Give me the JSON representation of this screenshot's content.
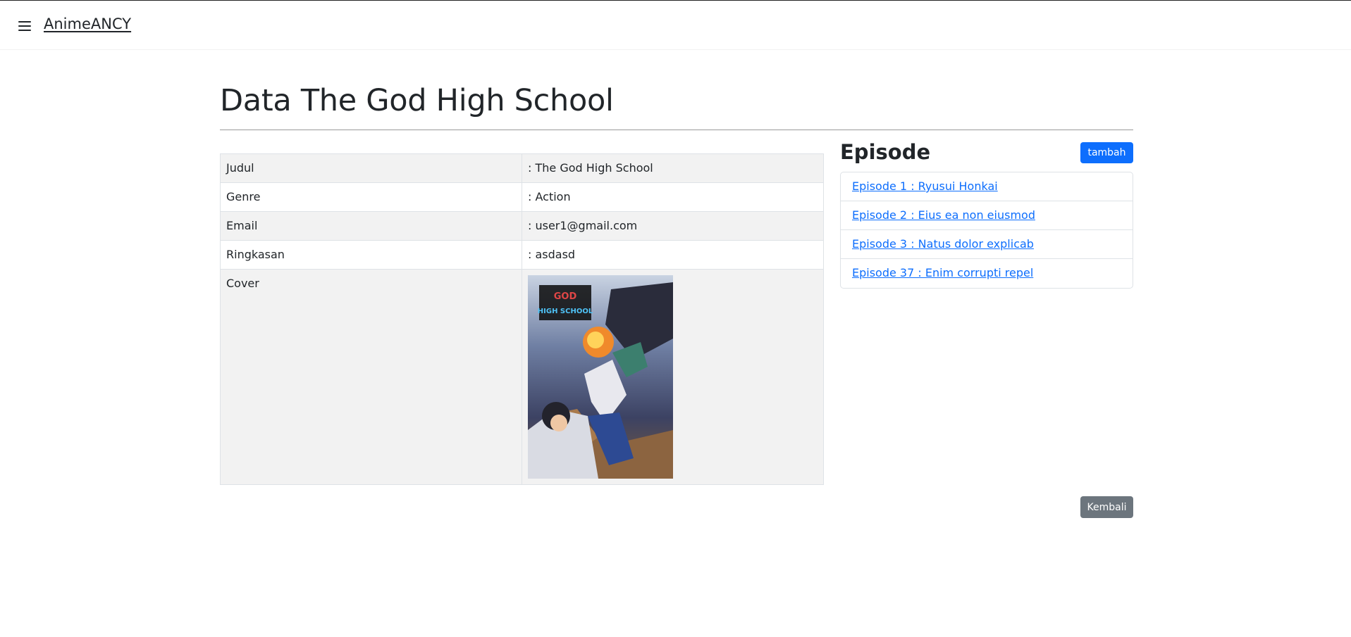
{
  "app": {
    "brand": "AnimeANCY"
  },
  "page": {
    "title": "Data The God High School"
  },
  "details": {
    "rows": [
      {
        "label": "Judul",
        "value": ": The God High School"
      },
      {
        "label": "Genre",
        "value": ": Action"
      },
      {
        "label": "Email",
        "value": ": user1@gmail.com"
      },
      {
        "label": "Ringkasan",
        "value": ": asdasd"
      },
      {
        "label": "Cover"
      }
    ]
  },
  "episodes": {
    "title": "Episode",
    "add_label": "tambah",
    "items": [
      "Episode 1 : Ryusui Honkai",
      "Episode 2 : Eius ea non eiusmod",
      "Episode 3 : Natus dolor explicab",
      "Episode 37 : Enim corrupti repel"
    ]
  },
  "actions": {
    "back_label": "Kembali"
  },
  "icons": {
    "menu": "hamburger-menu-icon"
  },
  "colors": {
    "primary": "#0d6efd",
    "secondary": "#6c757d",
    "table_stripe": "#f2f2f2"
  }
}
